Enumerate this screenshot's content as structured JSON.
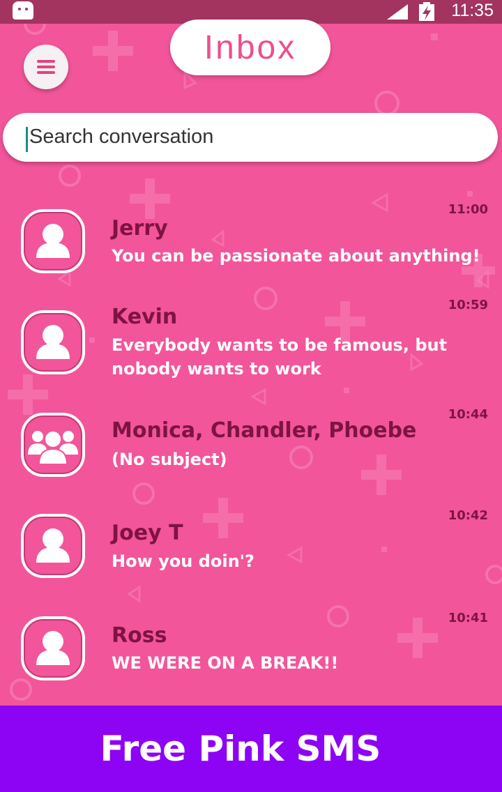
{
  "status_bar": {
    "time": "11:35",
    "icons": [
      "android-icon",
      "signal-icon",
      "battery-charging-icon"
    ]
  },
  "header": {
    "title": "Inbox",
    "menu_icon": "hamburger-menu-icon"
  },
  "search": {
    "placeholder": "Search conversation"
  },
  "conversations": [
    {
      "name": "Jerry",
      "message": " You can be passionate about anything!",
      "time": "11:00",
      "avatar": "person-icon"
    },
    {
      "name": "Kevin",
      "message": " Everybody wants to be famous, but nobody wants to work",
      "time": "10:59",
      "avatar": "person-icon"
    },
    {
      "name": "Monica, Chandler, Phoebe",
      "message": "(No subject)",
      "time": "10:44",
      "avatar": "group-icon"
    },
    {
      "name": "Joey T",
      "message": "How you doin'?",
      "time": "10:42",
      "avatar": "person-icon"
    },
    {
      "name": "Ross",
      "message": "WE WERE ON A BREAK!!",
      "time": "10:41",
      "avatar": "person-icon"
    }
  ],
  "banner": {
    "text": "Free Pink SMS"
  },
  "colors": {
    "background": "#f2559a",
    "status_bar": "#a2345f",
    "name_text": "#7e1342",
    "title_text": "#ee4d8e",
    "banner": "#8d04f5"
  }
}
